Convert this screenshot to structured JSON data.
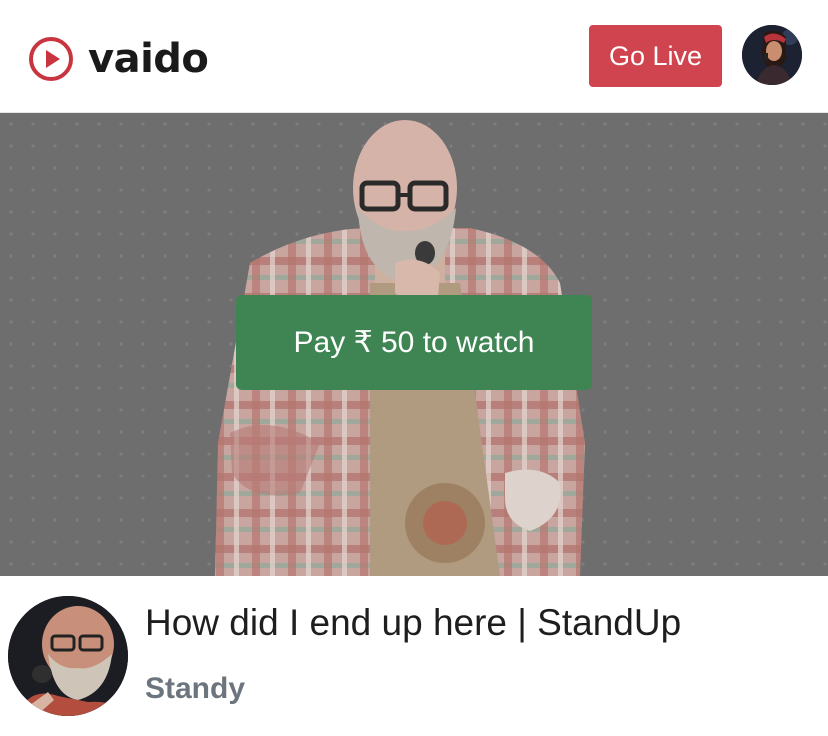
{
  "header": {
    "brand_name": "vaido",
    "go_live_label": "Go Live",
    "brand_color": "#c9353f"
  },
  "player": {
    "pay_label": "Pay ₹ 50 to watch",
    "button_color": "#3e8553"
  },
  "video": {
    "title": "How did I end up here | StandUp",
    "channel": "Standy"
  },
  "icons": {
    "logo": "play-circle-icon"
  }
}
